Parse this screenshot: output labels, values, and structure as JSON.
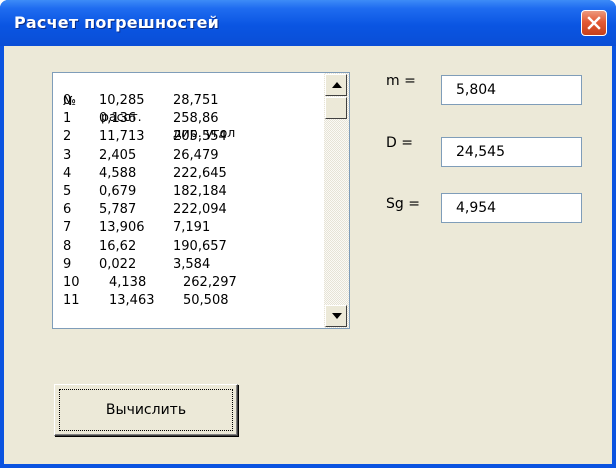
{
  "window": {
    "title": "Расчет погрешностей"
  },
  "list": {
    "headers": [
      "№",
      "расст.",
      "дир. угол"
    ],
    "rows": [
      [
        "0",
        "10,285",
        "28,751"
      ],
      [
        "1",
        "0,136",
        "258,86"
      ],
      [
        "2",
        "11,713",
        "205,554"
      ],
      [
        "3",
        "2,405",
        "26,479"
      ],
      [
        "4",
        "4,588",
        "222,645"
      ],
      [
        "5",
        "0,679",
        "182,184"
      ],
      [
        "6",
        "5,787",
        "222,094"
      ],
      [
        "7",
        "13,906",
        "7,191"
      ],
      [
        "8",
        "16,62",
        "190,657"
      ],
      [
        "9",
        "0,022",
        "3,584"
      ],
      [
        "10",
        "4,138",
        "262,297"
      ],
      [
        "11",
        "13,463",
        "50,508"
      ]
    ]
  },
  "results": {
    "m": {
      "label": "m =",
      "value": "5,804"
    },
    "D": {
      "label": "D =",
      "value": "24,545"
    },
    "Sg": {
      "label": "Sg =",
      "value": "4,954"
    }
  },
  "buttons": {
    "calculate": "Вычислить"
  },
  "icons": {
    "close": "close-icon",
    "scroll_up": "arrow-up-icon",
    "scroll_down": "arrow-down-icon"
  },
  "colors": {
    "titlebar": "#0a55e2",
    "face": "#ece9d8",
    "close": "#e35a35"
  }
}
